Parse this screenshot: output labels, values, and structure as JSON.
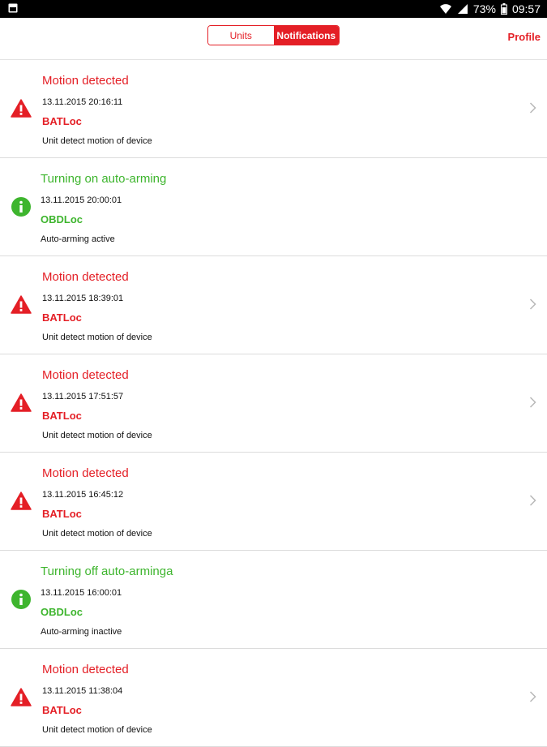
{
  "status_bar": {
    "left_icon": "photo-icon",
    "battery_percent": "73%",
    "time": "09:57",
    "icons": [
      "wifi-icon",
      "signal-icon",
      "battery-icon"
    ]
  },
  "header": {
    "tabs": [
      {
        "label": "Units",
        "active": false
      },
      {
        "label": "Notifications",
        "active": true
      }
    ],
    "profile_label": "Profile"
  },
  "colors": {
    "accent": "#e41f26",
    "info": "#3eb52e"
  },
  "notifications": [
    {
      "type": "alert",
      "icon": "warning-icon",
      "title": "Motion detected",
      "time": "13.11.2015 20:16:11",
      "device": "BATLoc",
      "description": "Unit detect motion of device",
      "has_chevron": true
    },
    {
      "type": "info",
      "icon": "info-icon",
      "title": "Turning on auto-arming",
      "time": "13.11.2015 20:00:01",
      "device": "OBDLoc",
      "description": "Auto-arming active",
      "has_chevron": false
    },
    {
      "type": "alert",
      "icon": "warning-icon",
      "title": "Motion detected",
      "time": "13.11.2015 18:39:01",
      "device": "BATLoc",
      "description": "Unit detect motion of device",
      "has_chevron": true
    },
    {
      "type": "alert",
      "icon": "warning-icon",
      "title": "Motion detected",
      "time": "13.11.2015 17:51:57",
      "device": "BATLoc",
      "description": "Unit detect motion of device",
      "has_chevron": true
    },
    {
      "type": "alert",
      "icon": "warning-icon",
      "title": "Motion detected",
      "time": "13.11.2015 16:45:12",
      "device": "BATLoc",
      "description": "Unit detect motion of device",
      "has_chevron": true
    },
    {
      "type": "info",
      "icon": "info-icon",
      "title": "Turning off auto-arminga",
      "time": "13.11.2015 16:00:01",
      "device": "OBDLoc",
      "description": "Auto-arming inactive",
      "has_chevron": false
    },
    {
      "type": "alert",
      "icon": "warning-icon",
      "title": "Motion detected",
      "time": "13.11.2015 11:38:04",
      "device": "BATLoc",
      "description": "Unit detect motion of device",
      "has_chevron": true
    }
  ]
}
